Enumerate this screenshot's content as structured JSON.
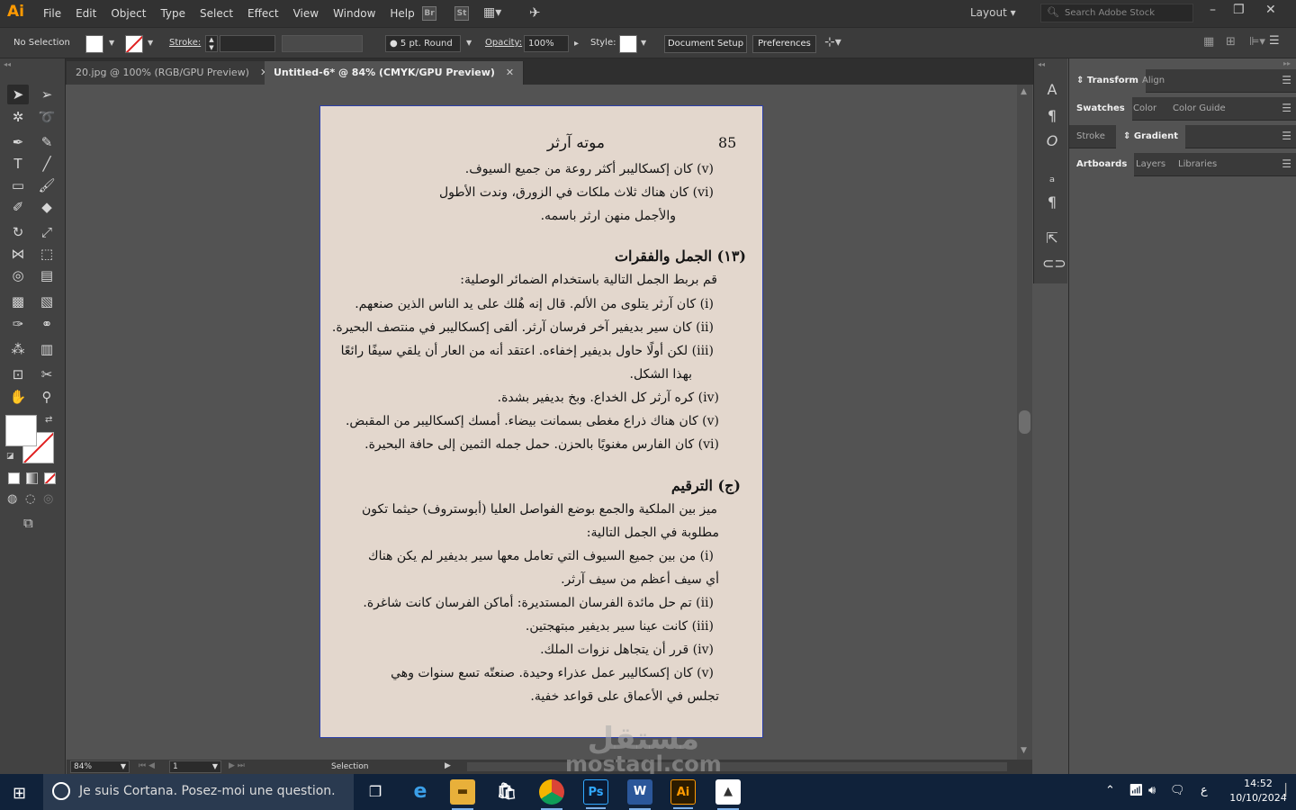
{
  "app": {
    "logo": "Ai",
    "menu": [
      "File",
      "Edit",
      "Object",
      "Type",
      "Select",
      "Effect",
      "View",
      "Window",
      "Help"
    ],
    "bridge_label": "Br",
    "stock_label": "St",
    "workspace": "Layout",
    "stock_search_placeholder": "Search Adobe Stock"
  },
  "control": {
    "selection": "No Selection",
    "stroke_label": "Stroke:",
    "brush": "5 pt. Round",
    "opacity_label": "Opacity:",
    "opacity": "100%",
    "style_label": "Style:",
    "doc_setup": "Document Setup",
    "preferences": "Preferences"
  },
  "tabs": [
    {
      "label": "20.jpg @ 100% (RGB/GPU Preview)",
      "active": false
    },
    {
      "label": "Untitled-6* @ 84% (CMYK/GPU Preview)",
      "active": true
    }
  ],
  "document": {
    "page_number": "85",
    "lines": [
      "موته آرثر",
      "(v) كان إكسكاليبر أكثر روعة من جميع السيوف.",
      "(vi) كان هناك ثلاث ملكات في الزورق، وندت الأطول",
      "والأجمل منهن ارثر باسمه.",
      "(١٣) الجمل والفقرات",
      "قم بربط الجمل التالية باستخدام الضمائر الوصلية:",
      "(i) كان آرثر يتلوى من الألم. قال إنه هُلك على يد الناس الذين صنعهم.",
      "(ii) كان سير بديفير آخر فرسان آرثر. ألقى إكسكاليبر في منتصف البحيرة.",
      "(iii) لكن أولًا حاول بديفير إخفاءه. اعتقد أنه من العار أن يلقي سيفًا رائعًا",
      "بهذا الشكل.",
      "(iv) كره آرثر كل الخداع. وبخ بديفير بشدة.",
      "(v) كان هناك ذراع مغطى بسمانت بيضاء. أمسك إكسكاليبر من المقبض.",
      "(vi) كان الفارس مغنويًا بالحزن. حمل جمله الثمين إلى حافة البحيرة.",
      "(ج) الترقيم",
      "ميز بين الملكية والجمع بوضع الفواصل العليا (أبوستروف) حيثما تكون",
      "مطلوبة في الجمل التالية:",
      "(i) من بين جميع السيوف التي تعامل معها سير بديفير لم يكن هناك",
      "أي سيف أعظم من سيف آرثر.",
      "(ii) تم حل مائدة الفرسان المستديرة: أماكن الفرسان كانت شاغرة.",
      "(iii) كانت عينا سير بديفير مبتهجتين.",
      "(iv) قرر أن يتجاهل نزوات الملك.",
      "(v) كان إكسكاليبر عمل عذراء وحيدة. صنعتّه تسع سنوات وهي",
      "تجلس في الأعماق على قواعد خفية."
    ]
  },
  "status": {
    "zoom": "84%",
    "page": "1",
    "tool": "Selection"
  },
  "panels": {
    "groups": [
      [
        "Transform",
        "Align"
      ],
      [
        "Swatches",
        "Color",
        "Color Guide"
      ],
      [
        "Stroke",
        "Gradient"
      ],
      [
        "Artboards",
        "Layers",
        "Libraries"
      ]
    ]
  },
  "taskbar": {
    "cortana": "Je suis Cortana. Posez-moi une question.",
    "time": "14:52",
    "date": "10/10/2024",
    "lang": "ع"
  },
  "watermark": {
    "arabic": "مستقل",
    "latin": "mostaql.com"
  }
}
